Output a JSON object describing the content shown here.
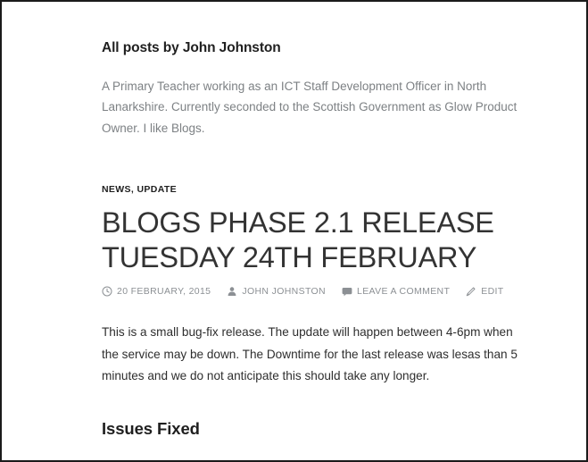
{
  "archive": {
    "title": "All posts by John Johnston",
    "description": "A Primary Teacher working as an ICT Staff Development Officer in North Lanarkshire. Currently seconded to the Scottish Government as Glow Product Owner. I like Blogs."
  },
  "post": {
    "categories": [
      {
        "label": "NEWS"
      },
      {
        "label": "UPDATE"
      }
    ],
    "category_separator": ",",
    "title": "Blogs Phase 2.1 Release Tuesday 24th February",
    "meta": {
      "date": "20 February, 2015",
      "author": "John Johnston",
      "comments": "Leave a comment",
      "edit": "Edit",
      "icons": {
        "date": "clock-icon",
        "author": "person-icon",
        "comments": "comment-bubble-icon",
        "edit": "pencil-icon"
      }
    },
    "body": {
      "paragraph_1": "This is a small bug-fix release. The update will happen between 4-6pm when the service may be down. The Downtime for the last release was lesas than 5 minutes and we do not anticipate this should take any longer.",
      "heading_1": "Issues Fixed"
    }
  },
  "colors": {
    "text_dark": "#1f1f1f",
    "title_grey": "#333333",
    "muted_grey": "#8c9094",
    "description_grey": "#7d8184",
    "background": "#ffffff",
    "frame_border": "#1b1b1b"
  }
}
